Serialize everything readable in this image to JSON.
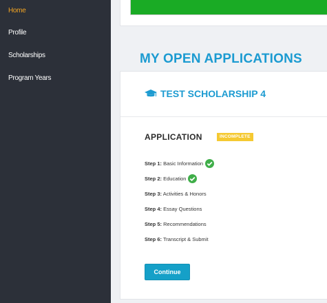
{
  "sidebar": {
    "items": [
      {
        "label": "Home",
        "active": true
      },
      {
        "label": "Profile",
        "active": false
      },
      {
        "label": "Scholarships",
        "active": false
      },
      {
        "label": "Program Years",
        "active": false
      }
    ]
  },
  "main": {
    "progress": {
      "percent": 100,
      "color": "#1aab25"
    },
    "section_title": "MY OPEN APPLICATIONS",
    "card": {
      "title": "TEST SCHOLARSHIP 4",
      "icon": "graduation-cap-icon",
      "application_heading": "APPLICATION",
      "status_badge": "INCOMPLETE",
      "steps": [
        {
          "num": "Step 1:",
          "label": "Basic Information",
          "complete": true
        },
        {
          "num": "Step 2:",
          "label": "Education",
          "complete": true
        },
        {
          "num": "Step 3:",
          "label": "Activities & Honors",
          "complete": false
        },
        {
          "num": "Step 4:",
          "label": "Essay Questions",
          "complete": false
        },
        {
          "num": "Step 5:",
          "label": "Recommendations",
          "complete": false
        },
        {
          "num": "Step 6:",
          "label": "Transcript & Submit",
          "complete": false
        }
      ],
      "continue_label": "Continue"
    }
  },
  "colors": {
    "sidebar_bg": "#2c3039",
    "active_nav": "#f5a623",
    "accent_blue": "#1c9bd1",
    "badge_yellow": "#f5c932",
    "check_green": "#3fae49",
    "button_blue": "#15a0c8"
  }
}
